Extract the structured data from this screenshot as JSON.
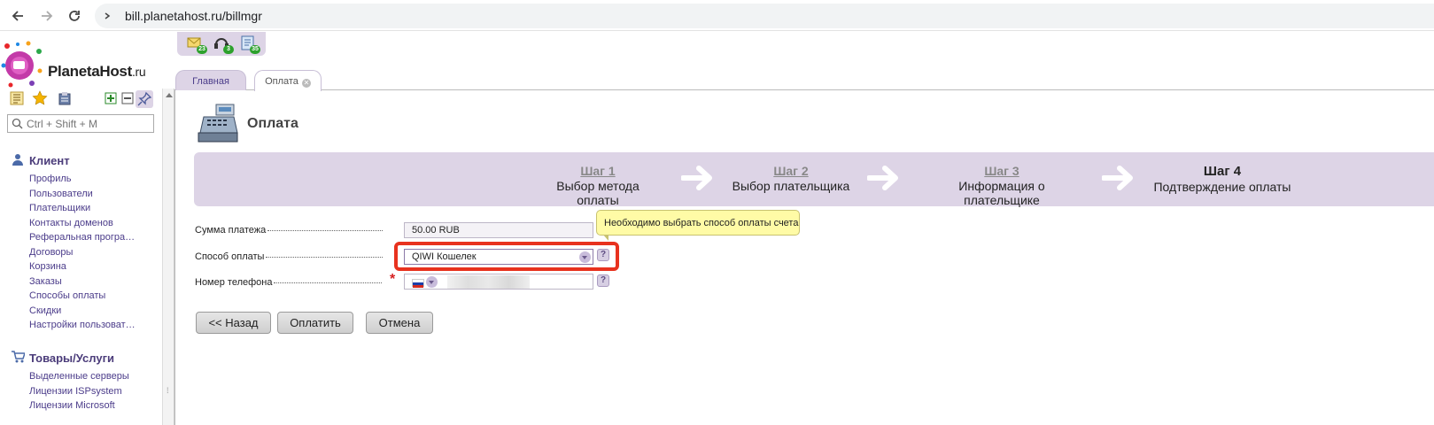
{
  "browser": {
    "url": "bill.planetahost.ru/billmgr"
  },
  "logo": {
    "name": "PlanetaHost",
    "suffix": ".ru"
  },
  "sidebar": {
    "search_placeholder": "Ctrl + Shift + M",
    "sections": [
      {
        "title": "Клиент",
        "items": [
          "Профиль",
          "Пользователи",
          "Плательщики",
          "Контакты доменов",
          "Реферальная програ…",
          "Договоры",
          "Корзина",
          "Заказы",
          "Способы оплаты",
          "Скидки",
          "Настройки пользоват…"
        ]
      },
      {
        "title": "Товары/Услуги",
        "items": [
          "Выделенные серверы",
          "Лицензии ISPsystem",
          "Лицензии Microsoft"
        ]
      }
    ]
  },
  "top_icons": [
    {
      "icon": "messages-icon",
      "badge": "23"
    },
    {
      "icon": "support-icon",
      "badge": "3"
    },
    {
      "icon": "notes-icon",
      "badge": "35"
    }
  ],
  "tabs": [
    {
      "label": "Главная"
    },
    {
      "label": "Оплата"
    }
  ],
  "page": {
    "title": "Оплата"
  },
  "steps": [
    {
      "num": "Шаг 1",
      "desc": "Выбор метода оплаты",
      "active": false
    },
    {
      "num": "Шаг 2",
      "desc": "Выбор плательщика",
      "active": false
    },
    {
      "num": "Шаг 3",
      "desc": "Информация о плательщике",
      "active": false
    },
    {
      "num": "Шаг 4",
      "desc": "Подтверждение оплаты",
      "active": true
    }
  ],
  "form": {
    "amount_label": "Сумма платежа",
    "amount_value": "50.00 RUB",
    "method_label": "Способ оплаты",
    "method_value": "QIWI Кошелек",
    "phone_label": "Номер телефона",
    "help": "?",
    "tooltip": "Необходимо выбрать способ оплаты счета"
  },
  "buttons": {
    "back": "<< Назад",
    "pay": "Оплатить",
    "cancel": "Отмена"
  },
  "colors": {
    "accent": "#ddd4e6",
    "link": "#4b3c8a",
    "highlight": "#e8321e",
    "tooltip": "#fffba6"
  }
}
